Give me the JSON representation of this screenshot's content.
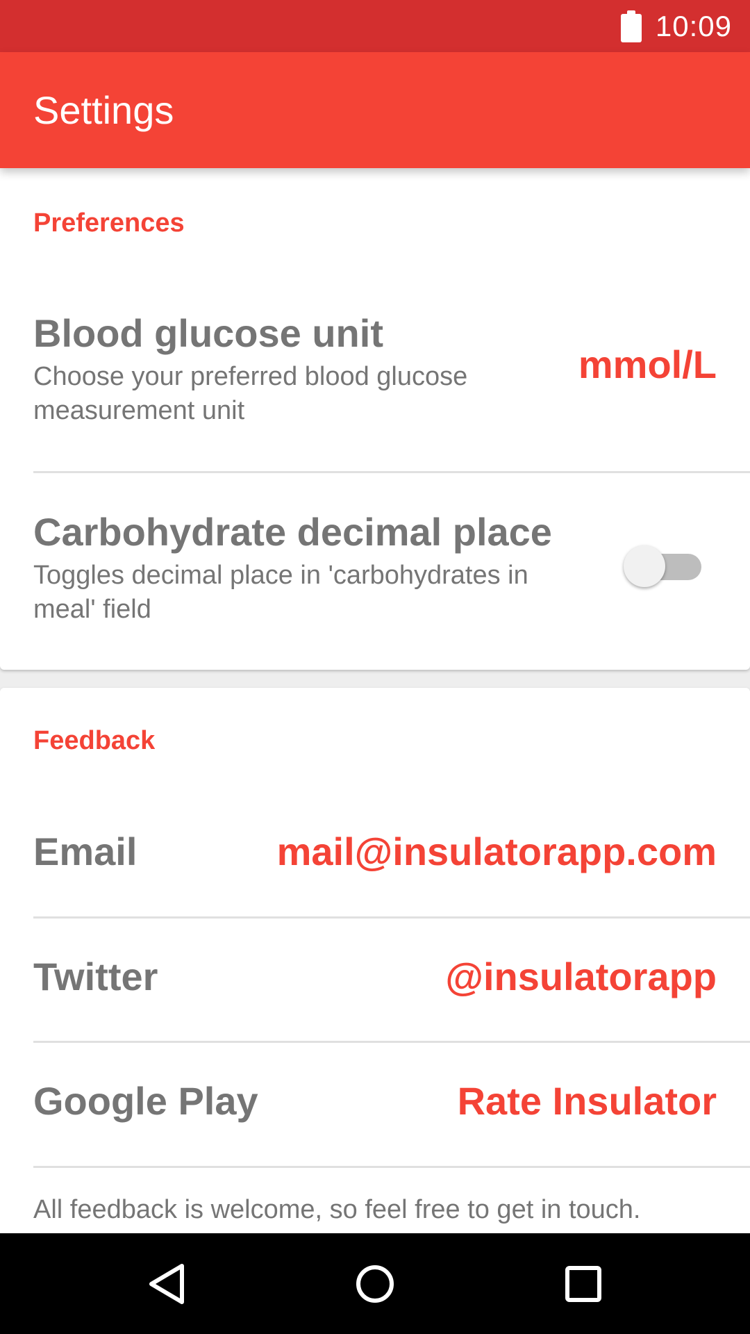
{
  "status_bar": {
    "time": "10:09",
    "icons": [
      "battery-icon"
    ]
  },
  "app_bar": {
    "title": "Settings"
  },
  "preferences": {
    "header": "Preferences",
    "blood_glucose": {
      "title": "Blood glucose unit",
      "subtitle_line1": "Choose your preferred blood glucose",
      "subtitle_line2": "measurement unit",
      "value": "mmol/L"
    },
    "carb_decimal": {
      "title": "Carbohydrate decimal place",
      "subtitle_line1": "Toggles decimal place in 'carbohydrates in",
      "subtitle_line2": "meal' field",
      "enabled": false
    }
  },
  "feedback": {
    "header": "Feedback",
    "email": {
      "label": "Email",
      "value": "mail@insulatorapp.com"
    },
    "twitter": {
      "label": "Twitter",
      "value": "@insulatorapp"
    },
    "google_play": {
      "label": "Google Play",
      "value": "Rate Insulator"
    },
    "footer": "All feedback is welcome, so feel free to get in touch."
  },
  "nav_bar": {
    "icons": [
      "back-icon",
      "home-icon",
      "recents-icon"
    ]
  },
  "colors": {
    "status_bar": "#d32f2f",
    "primary": "#f44336",
    "text_secondary": "#757575",
    "divider": "#e0e0e0"
  }
}
